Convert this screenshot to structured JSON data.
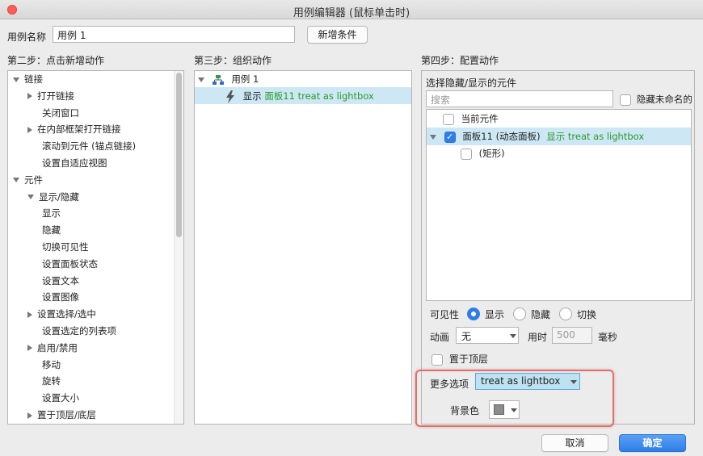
{
  "window": {
    "title": "用例编辑器 (鼠标单击时)"
  },
  "case_name": {
    "label": "用例名称",
    "value": "用例 1"
  },
  "add_condition_button": "新增条件",
  "step2": {
    "heading": "第二步：点击新增动作",
    "items": [
      {
        "label": "链接",
        "expanded": true,
        "level": 0
      },
      {
        "label": "打开链接",
        "expandable": true,
        "level": 1
      },
      {
        "label": "关闭窗口",
        "level": 1
      },
      {
        "label": "在内部框架打开链接",
        "expandable": true,
        "level": 1
      },
      {
        "label": "滚动到元件 (锚点链接)",
        "level": 1
      },
      {
        "label": "设置自适应视图",
        "level": 1
      },
      {
        "label": "元件",
        "expanded": true,
        "level": 0
      },
      {
        "label": "显示/隐藏",
        "expanded": true,
        "level": 1
      },
      {
        "label": "显示",
        "level": 2
      },
      {
        "label": "隐藏",
        "level": 2
      },
      {
        "label": "切换可见性",
        "level": 2
      },
      {
        "label": "设置面板状态",
        "level": 1
      },
      {
        "label": "设置文本",
        "level": 1
      },
      {
        "label": "设置图像",
        "level": 1
      },
      {
        "label": "设置选择/选中",
        "expandable": true,
        "level": 1
      },
      {
        "label": "设置选定的列表项",
        "level": 1
      },
      {
        "label": "启用/禁用",
        "expandable": true,
        "level": 1
      },
      {
        "label": "移动",
        "level": 1
      },
      {
        "label": "旋转",
        "level": 1
      },
      {
        "label": "设置大小",
        "level": 1
      },
      {
        "label": "置于顶层/底层",
        "expandable": true,
        "level": 1
      }
    ]
  },
  "step3": {
    "heading": "第三步：组织动作",
    "case_label": "用例 1",
    "action_verb": "显示",
    "action_detail": "面板11 treat as lightbox"
  },
  "step4": {
    "heading": "第四步：配置动作",
    "select_label": "选择隐藏/显示的元件",
    "search_placeholder": "搜索",
    "hide_unnamed_label": "隐藏未命名的",
    "widgets": [
      {
        "label": "当前元件",
        "checked": false
      },
      {
        "label": "面板11 (动态面板)",
        "extra": "显示 treat as lightbox",
        "checked": true
      },
      {
        "label": "(矩形)",
        "checked": false
      }
    ],
    "visibility_label": "可见性",
    "visibility_options": [
      "显示",
      "隐藏",
      "切换"
    ],
    "visibility_selected": "显示",
    "animation_label": "动画",
    "animation_value": "无",
    "duration_label": "用时",
    "duration_value": "500",
    "duration_unit": "毫秒",
    "bring_to_front_label": "置于顶层",
    "more_options_label": "更多选项",
    "more_options_value": "treat as lightbox",
    "bg_color_label": "背景色",
    "bg_color": "#8c8c8c"
  },
  "buttons": {
    "cancel": "取消",
    "ok": "确定"
  },
  "colors": {
    "accent": "#2f7ee8",
    "selection": "#cde8f4",
    "action_green": "#2a9a2a",
    "highlight_border": "#e0706a"
  }
}
